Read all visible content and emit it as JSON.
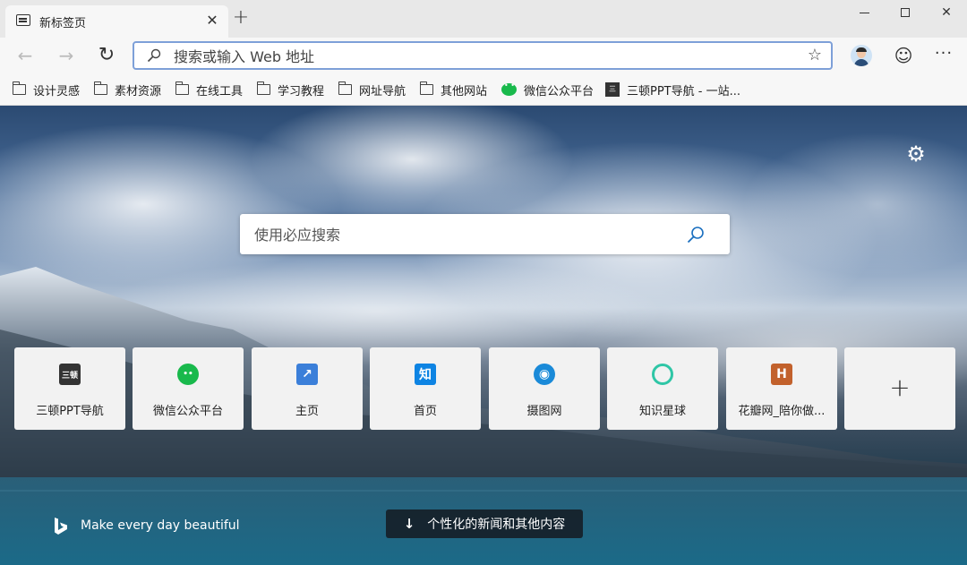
{
  "window": {
    "tab_title": "新标签页",
    "tab_close": "✕",
    "new_tab": "+",
    "minimize_icon": "minimize-icon",
    "maximize_icon": "maximize-icon",
    "close_glyph": "✕"
  },
  "toolbar": {
    "back_glyph": "←",
    "forward_glyph": "→",
    "refresh_glyph": "↻",
    "address_placeholder": "搜索或输入 Web 地址",
    "favorite_glyph": "☆",
    "emoji_glyph": "☺",
    "more_glyph": "···"
  },
  "bookmarks": [
    {
      "label": "设计灵感",
      "icon": "folder-icon"
    },
    {
      "label": "素材资源",
      "icon": "folder-icon"
    },
    {
      "label": "在线工具",
      "icon": "folder-icon"
    },
    {
      "label": "学习教程",
      "icon": "folder-icon"
    },
    {
      "label": "网址导航",
      "icon": "folder-icon"
    },
    {
      "label": "其他网站",
      "icon": "folder-icon"
    },
    {
      "label": "微信公众平台",
      "icon": "wechat-icon"
    },
    {
      "label": "三顿PPT导航 - 一站...",
      "icon": "sandun-icon"
    }
  ],
  "newtab": {
    "search_placeholder": "使用必应搜索",
    "tiles": [
      {
        "label": "三顿PPT导航",
        "icon": "sandun-icon",
        "color": "#333333",
        "glyph": "三顿"
      },
      {
        "label": "微信公众平台",
        "icon": "wechat-icon",
        "color": "#19b94c",
        "glyph": "••"
      },
      {
        "label": "主页",
        "icon": "chart-icon",
        "color": "#3b7fd9",
        "glyph": "↗"
      },
      {
        "label": "首页",
        "icon": "zhihu-icon",
        "color": "#0e84e3",
        "glyph": "知"
      },
      {
        "label": "摄图网",
        "icon": "shetu-icon",
        "color": "#1a8ad8",
        "glyph": "◉"
      },
      {
        "label": "知识星球",
        "icon": "zsxq-icon",
        "color": "#2fc6a6",
        "glyph": "◌"
      },
      {
        "label": "花瓣网_陪你做...",
        "icon": "huaban-icon",
        "color": "#c2612c",
        "glyph": "H"
      }
    ],
    "add_glyph": "+",
    "tagline": "Make every day beautiful",
    "news_arrow": "↓",
    "news_label": "个性化的新闻和其他内容"
  },
  "colors": {
    "address_border": "#7ea0d8",
    "titlebar": "#e8e8e8",
    "toolbar": "#f7f7f7"
  }
}
